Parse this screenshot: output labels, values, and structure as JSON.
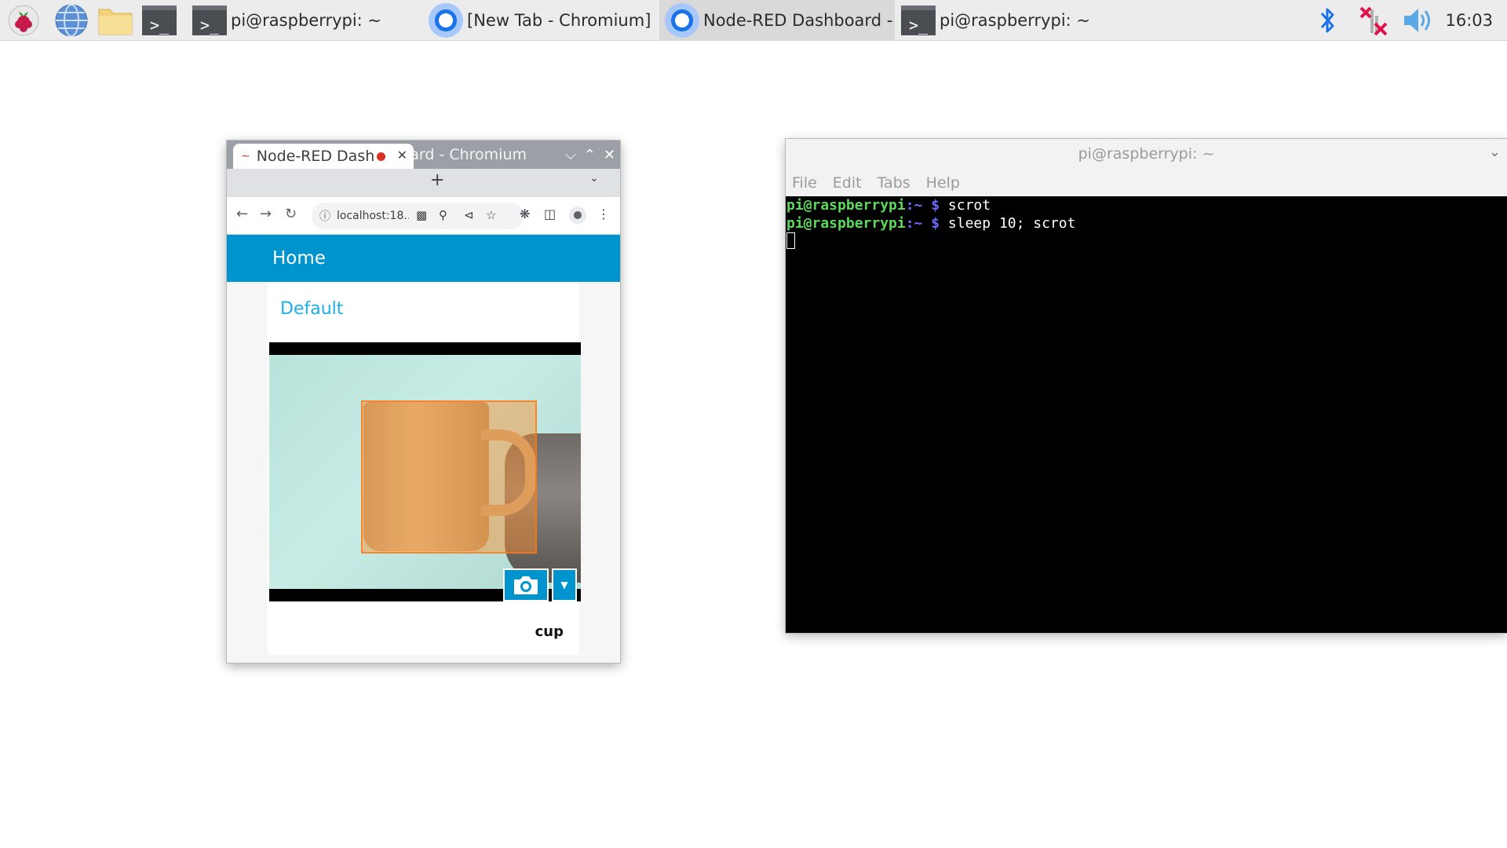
{
  "taskbar": {
    "launchers": [
      {
        "name": "raspberry-menu",
        "icon": "raspberry-icon"
      },
      {
        "name": "web-browser",
        "icon": "globe-icon"
      },
      {
        "name": "file-manager",
        "icon": "folder-icon"
      },
      {
        "name": "terminal",
        "icon": "terminal-icon"
      }
    ],
    "tasks": [
      {
        "label": "pi@raspberrypi: ~",
        "icon": "terminal-icon"
      },
      {
        "label": "[New Tab - Chromium]",
        "icon": "chromium-icon"
      },
      {
        "label": "Node-RED Dashboard - ...",
        "icon": "chromium-icon",
        "active": true
      },
      {
        "label": "pi@raspberrypi: ~",
        "icon": "terminal-icon"
      }
    ],
    "tray": [
      "bluetooth-icon",
      "network-disconnected-icon",
      "volume-icon"
    ],
    "clock": "16:03"
  },
  "chromium": {
    "title": "Node-RED Dashboard - Chromium",
    "tab_title": "Node-RED Dash",
    "url": "localhost:18...",
    "new_tab": "+",
    "dashboard": {
      "header": "Home",
      "group": "Default",
      "detected_label": "cup"
    }
  },
  "terminal": {
    "title": "pi@raspberrypi: ~",
    "menu": [
      "File",
      "Edit",
      "Tabs",
      "Help"
    ],
    "lines": [
      {
        "user": "pi@raspberrypi",
        "path": ":~",
        "prompt": " $ ",
        "cmd": "scrot"
      },
      {
        "user": "pi@raspberrypi",
        "path": ":~",
        "prompt": " $ ",
        "cmd": "sleep 10; scrot"
      }
    ]
  },
  "colors": {
    "dashboard_header": "#0094ce",
    "group_title": "#1bb1e6",
    "terminal_user": "#5bd95b",
    "terminal_path": "#6b6bff",
    "bbox": "#ff8c28"
  }
}
